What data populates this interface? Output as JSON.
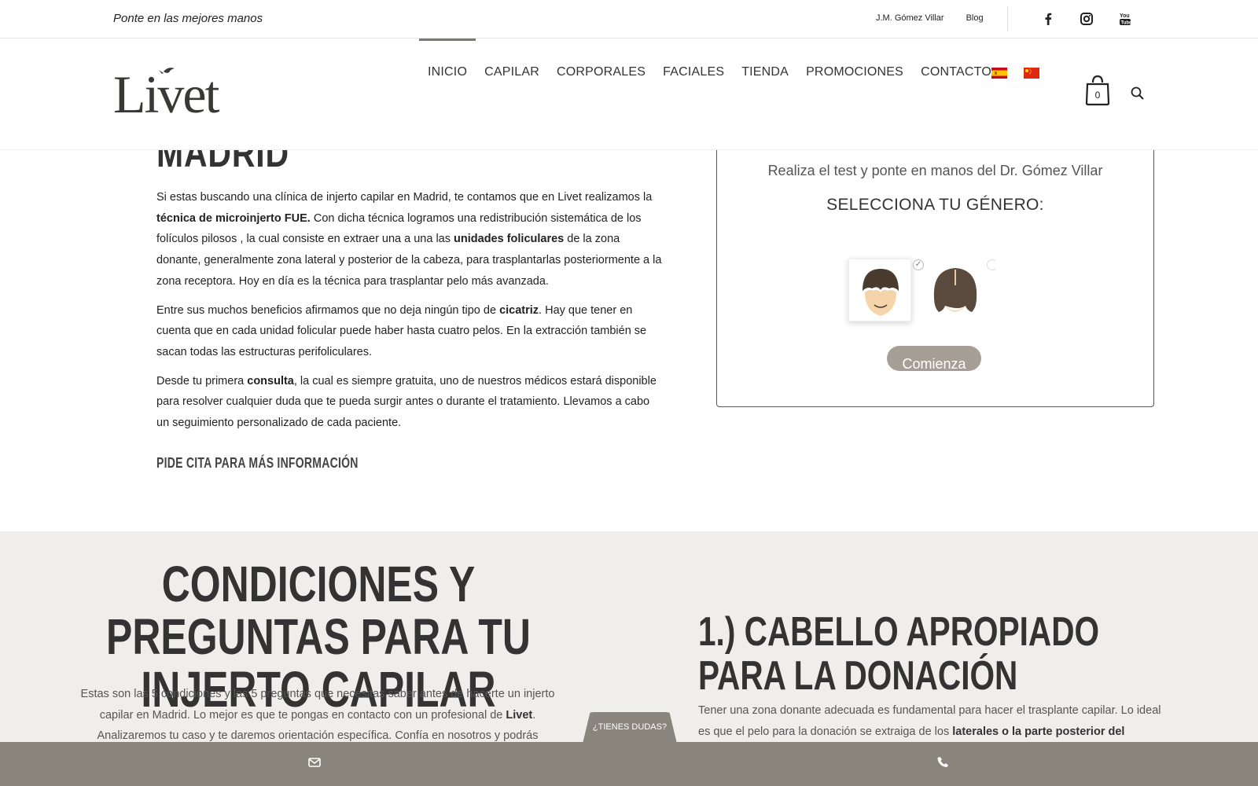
{
  "topbar": {
    "tagline": "Ponte en las mejores manos",
    "links": [
      "J.M. Gómez Villar",
      "Blog"
    ],
    "social_icons": [
      "facebook-icon",
      "instagram-icon",
      "youtube-icon"
    ]
  },
  "header": {
    "logo_text": "Livet",
    "nav": [
      "INICIO",
      "CAPILAR",
      "CORPORALES",
      "FACIALES",
      "TIENDA",
      "PROMOCIONES",
      "CONTACTO"
    ],
    "active_nav": "INICIO",
    "flags": [
      "spain-flag-icon",
      "china-flag-icon"
    ],
    "cart_count": "0"
  },
  "content": {
    "heading": "MADRID",
    "p1_a": "Si estas buscando una clínica de injerto capilar en Madrid, te contamos que en Livet realizamos la ",
    "p1_b": "técnica de microinjerto FUE.",
    "p1_c": " Con dicha técnica logramos una redistribución sistemática de los folículos pilosos , la cual consiste en extraer una a una las ",
    "p1_d": "unidades foliculares",
    "p1_e": " de la zona donante, generalmente zona lateral y posterior de la cabeza, para trasplantarlas posteriormente a la zona receptora. Hoy en día es la técnica para trasplantar pelo más avanzada.",
    "p2_a": "Entre sus muchos beneficios afirmamos que no deja ningún tipo de ",
    "p2_b": "cicatriz",
    "p2_c": ". Hay que tener en cuenta que en cada unidad folicular puede haber hasta cuatro pelos. En la extracción también se sacan todas las estructuras perifoliculares.",
    "p3_a": "Desde tu primera ",
    "p3_b": "consulta",
    "p3_c": ", la cual es siempre gratuita, uno de nuestros médicos estará disponible para resolver cualquier duda que te pueda surgir antes o durante el tratamiento. Llevamos a cabo un seguimiento personalizado de cada paciente.",
    "cta": "PIDE CITA PARA MÁS INFORMACIÓN"
  },
  "test": {
    "subtitle": "Realiza el test y ponte en manos del Dr. Gómez Villar",
    "title": "SELECCIONA TU GÉNERO:",
    "selected": "male",
    "button": "Comienza"
  },
  "lower": {
    "title": "CONDICIONES Y PREGUNTAS PARA TU INJERTO CAPILAR",
    "p_a": "Estas son las 5 condiciones y las 5 preguntas que necesitas saber antes de hacerte un injerto capilar en Madrid. Lo mejor es que te pongas en contacto con un profesional de ",
    "p_b": "Livet",
    "p_c": ". Analizaremos tu caso y te daremos orientación específica. Confía en nosotros y podrás",
    "right_title": "1.) CABELLO APROPIADO PARA LA DONACIÓN",
    "right_p_a": "Tener una zona donante adecuada es fundamental para hacer el trasplante capilar. Lo ideal es que el pelo para la donación se extraiga de los ",
    "right_p_b": "laterales o la parte posterior del"
  },
  "bottom": {
    "doubts": "¿TIENES DUDAS?"
  },
  "colors": {
    "accent": "#8a857c",
    "button": "#a59e95",
    "section_bg": "#efeeea"
  }
}
